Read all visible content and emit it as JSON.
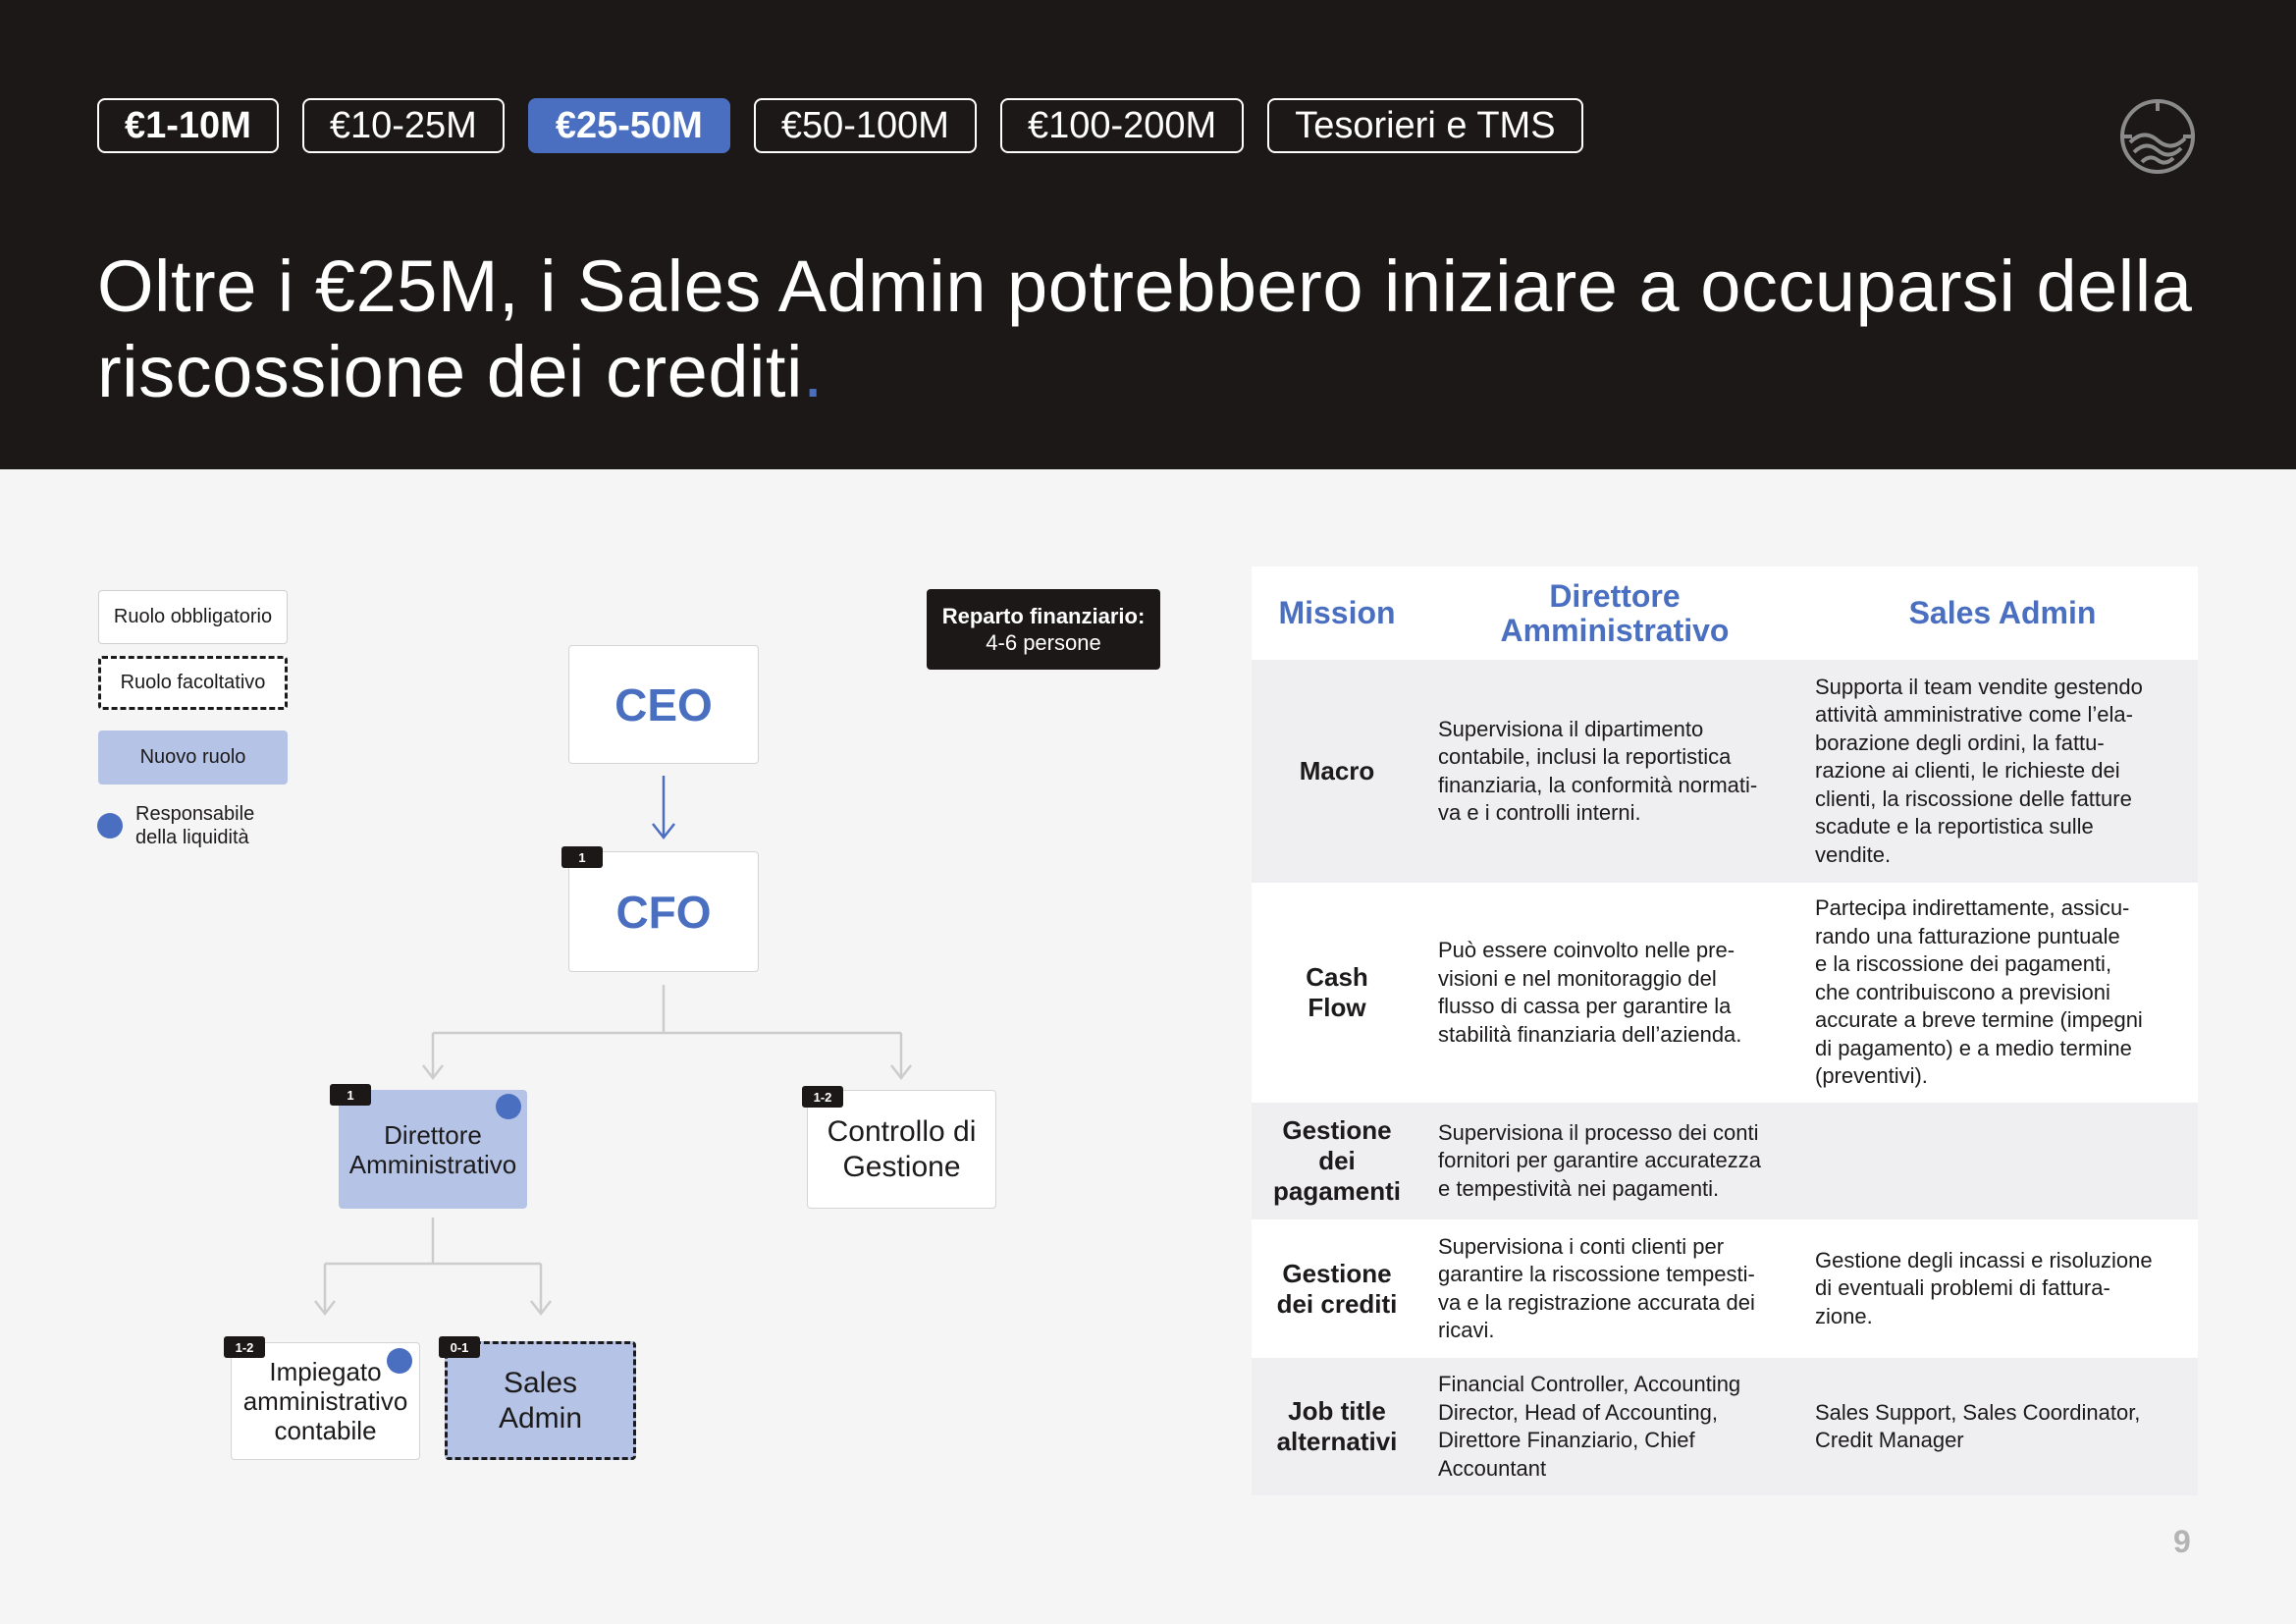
{
  "tabs": [
    {
      "label": "€1-10M"
    },
    {
      "label": "€10-25M"
    },
    {
      "label": "€25-50M",
      "active": true
    },
    {
      "label": "€50-100M"
    },
    {
      "label": "€100-200M"
    },
    {
      "label": "Tesorieri e TMS"
    }
  ],
  "title": {
    "text": "Oltre i €25M, i Sales Admin potrebbero iniziare a occuparsi della riscossione dei crediti",
    "dot": "."
  },
  "logo": {
    "icon": "wave-circle-logo"
  },
  "legend": {
    "mandatory": "Ruolo obbligatorio",
    "optional": "Ruolo facoltativo",
    "new_role": "Nuovo ruolo",
    "liquidity_line1": "Responsabile",
    "liquidity_line2": "della liquidità"
  },
  "department": {
    "label": "Reparto finanziario:",
    "count": "4-6 persone"
  },
  "org": {
    "ceo": "CEO",
    "cfo": {
      "label": "CFO",
      "badge": "1"
    },
    "direttore": {
      "line1": "Direttore",
      "line2": "Amministrativo",
      "badge": "1"
    },
    "controllo": {
      "line1": "Controllo di",
      "line2": "Gestione",
      "badge": "1-2"
    },
    "impiegato": {
      "line1": "Impiegato",
      "line2": "amministrativo",
      "line3": "contabile",
      "badge": "1-2"
    },
    "sales_admin": {
      "line1": "Sales",
      "line2": "Admin",
      "badge": "0-1"
    }
  },
  "table": {
    "headers": {
      "mission": "Mission",
      "col1_line1": "Direttore",
      "col1_line2": "Amministrativo",
      "col2": "Sales Admin"
    },
    "rows": [
      {
        "label": "Macro",
        "col1": "Supervisiona il dipartimento\ncontabile, inclusi la reportistica\nfinanziaria, la conformità normati-\nva e i controlli interni.",
        "col2": "Supporta il team vendite gestendo\nattività amministrative come l’ela-\nborazione degli ordini, la fattu-\nrazione ai clienti, le richieste dei\nclienti, la riscossione delle fatture\nscadute e la reportistica sulle\nvendite."
      },
      {
        "label": "Cash\nFlow",
        "col1": "Può essere coinvolto nelle pre-\nvisioni e nel monitoraggio del\nflusso di cassa per garantire la\nstabilità finanziaria dell’azienda.",
        "col2": "Partecipa indirettamente, assicu-\nrando una fatturazione puntuale\ne la riscossione dei pagamenti,\nche contribuiscono a previsioni\naccurate a breve termine (impegni\ndi pagamento) e a medio termine\n(preventivi)."
      },
      {
        "label": "Gestione\ndei\npagamenti",
        "col1": "Supervisiona il processo dei conti\nfornitori per garantire accuratezza\ne tempestività nei pagamenti.",
        "col2": ""
      },
      {
        "label": "Gestione\ndei crediti",
        "col1": "Supervisiona i conti clienti per\ngarantire la riscossione tempesti-\nva e la registrazione accurata dei\nricavi.",
        "col2": "Gestione degli incassi e risoluzione\ndi eventuali problemi di fattura-\nzione."
      },
      {
        "label": "Job title\nalternativi",
        "col1": "Financial Controller, Accounting\nDirector, Head of Accounting,\nDirettore Finanziario, Chief\nAccountant",
        "col2": "Sales Support, Sales Coordinator,\nCredit Manager"
      }
    ]
  },
  "page_number": "9"
}
